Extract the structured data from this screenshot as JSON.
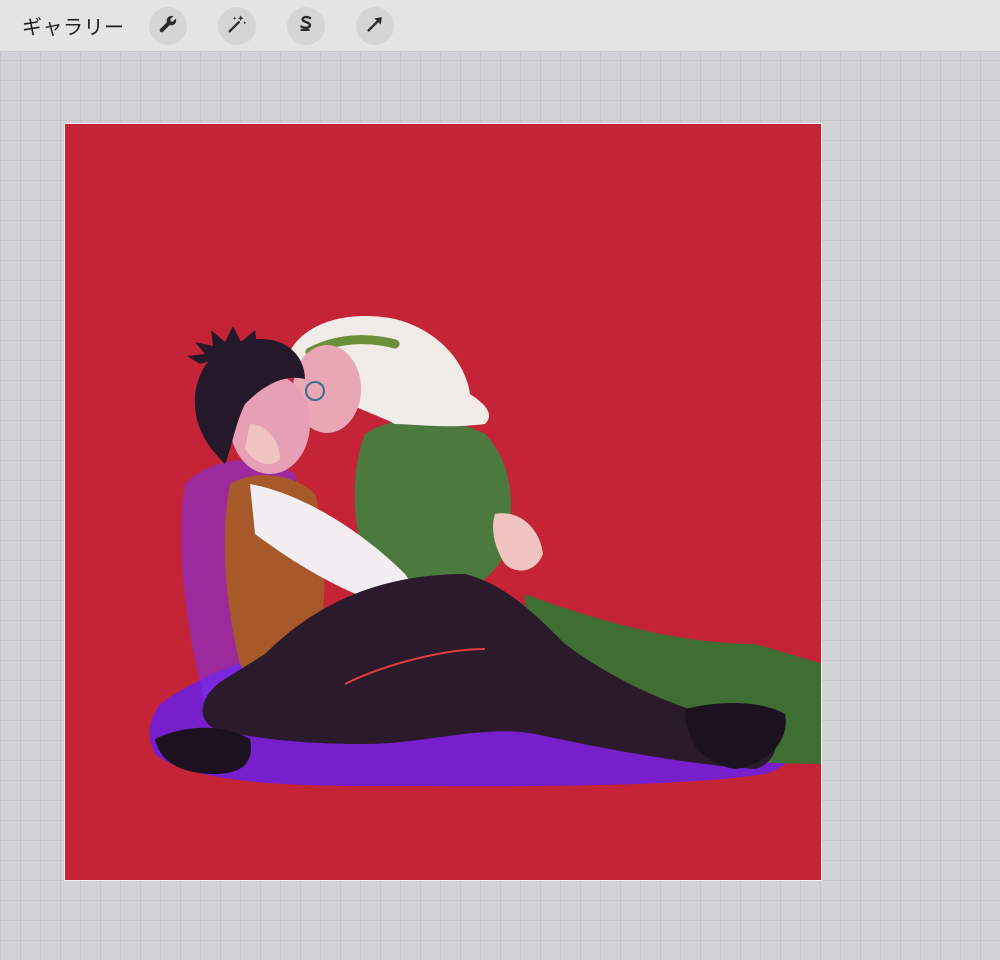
{
  "toolbar": {
    "gallery_label": "ギャラリー",
    "tools": [
      {
        "name": "actions",
        "icon": "wrench-icon"
      },
      {
        "name": "adjustments",
        "icon": "magic-wand-icon"
      },
      {
        "name": "selection",
        "icon": "selection-s-icon"
      },
      {
        "name": "transform",
        "icon": "arrow-cursor-icon"
      }
    ]
  },
  "canvas": {
    "background_color": "#c42436",
    "artwork": "illustration-couple-embracing"
  },
  "colors": {
    "toolbar_bg": "#e4e4e4",
    "workspace_bg": "#d1d3d6",
    "icon_color": "#2b2b2b"
  }
}
